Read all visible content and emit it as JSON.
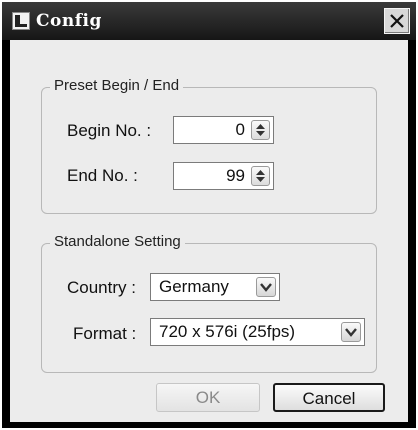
{
  "window": {
    "title": "Config",
    "app_icon": "app-window-icon",
    "close_icon": "close-icon"
  },
  "preset": {
    "legend": "Preset Begin / End",
    "begin_label": "Begin No. :",
    "begin_value": "0",
    "end_label": "End No. :",
    "end_value": "99"
  },
  "standalone": {
    "legend": "Standalone Setting",
    "country_label": "Country :",
    "country_value": "Germany",
    "format_label": "Format :",
    "format_value": "720 x 576i (25fps)"
  },
  "buttons": {
    "ok_label": "OK",
    "cancel_label": "Cancel"
  }
}
